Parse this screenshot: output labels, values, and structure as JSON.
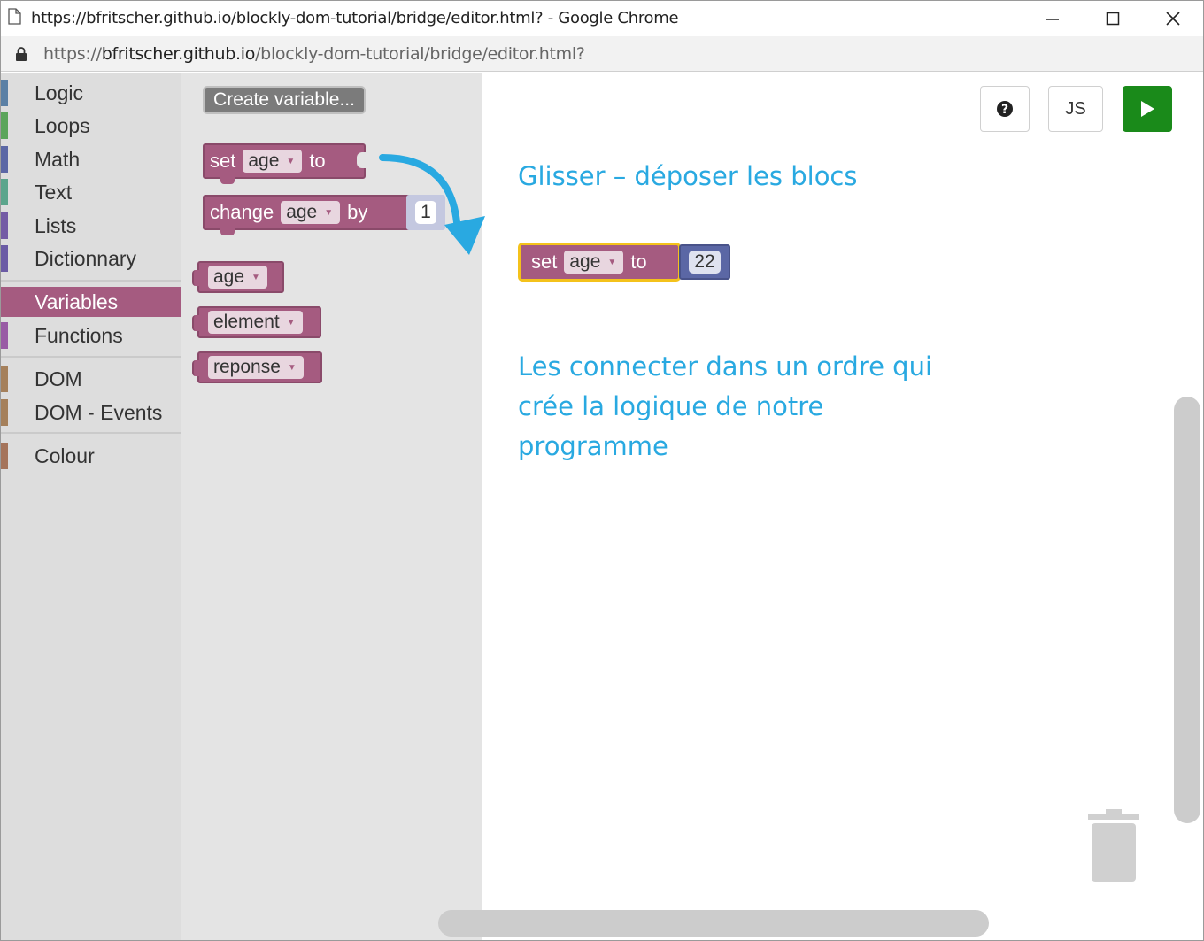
{
  "browser": {
    "title": "https://bfritscher.github.io/blockly-dom-tutorial/bridge/editor.html? - Google Chrome",
    "url_scheme": "https://",
    "url_host": "bfritscher.github.io",
    "url_path": "/blockly-dom-tutorial/bridge/editor.html?"
  },
  "toolbox": {
    "categories": [
      {
        "label": "Logic",
        "color": "#5b80a5"
      },
      {
        "label": "Loops",
        "color": "#5ba55b"
      },
      {
        "label": "Math",
        "color": "#5b67a5"
      },
      {
        "label": "Text",
        "color": "#5ba58c"
      },
      {
        "label": "Lists",
        "color": "#745ba5"
      },
      {
        "label": "Dictionnary",
        "color": "#6b5ba5"
      },
      {
        "label": "Variables",
        "color": "#a55b80"
      },
      {
        "label": "Functions",
        "color": "#995ba5"
      },
      {
        "label": "DOM",
        "color": "#a5805b"
      },
      {
        "label": "DOM - Events",
        "color": "#a5805b"
      },
      {
        "label": "Colour",
        "color": "#a5745b"
      }
    ],
    "selected": "Variables"
  },
  "flyout": {
    "create_variable": "Create variable...",
    "set_block": {
      "kw1": "set",
      "var": "age",
      "kw2": "to"
    },
    "change_block": {
      "kw1": "change",
      "var": "age",
      "kw2": "by",
      "value": "1"
    },
    "var_getters": [
      "age",
      "element",
      "reponse"
    ]
  },
  "workspace": {
    "help_icon": "question-circle-icon",
    "js_button": "JS",
    "run_icon": "play-icon",
    "annotation_1": "Glisser – déposer les blocs",
    "annotation_2": "Les connecter dans un ordre qui crée la logique de notre programme",
    "placed_block": {
      "kw1": "set",
      "var": "age",
      "kw2": "to",
      "value": "22"
    },
    "trash_icon": "trash-icon"
  },
  "colors": {
    "variables": "#a55b80",
    "math": "#5b67a5",
    "annotation": "#29a9e1",
    "run": "#1a8a1a",
    "highlight": "#f4c21b"
  }
}
